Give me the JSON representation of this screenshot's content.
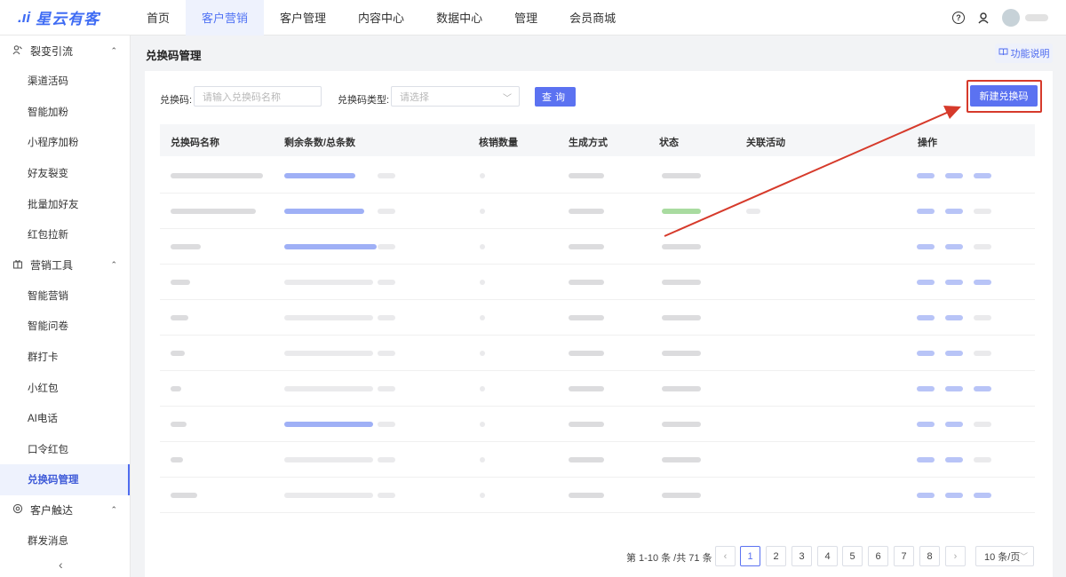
{
  "app": {
    "logo_mark": ".ıi",
    "name": "星云有客"
  },
  "nav": [
    {
      "label": "首页",
      "active": false
    },
    {
      "label": "客户营销",
      "active": true
    },
    {
      "label": "客户管理",
      "active": false
    },
    {
      "label": "内容中心",
      "active": false
    },
    {
      "label": "数据中心",
      "active": false
    },
    {
      "label": "管理",
      "active": false
    },
    {
      "label": "会员商城",
      "active": false
    }
  ],
  "topbar_icons": [
    "help-icon",
    "user-switch-icon"
  ],
  "sidebar": {
    "groups": [
      {
        "title": "裂变引流",
        "icon": "people-icon",
        "items": [
          "渠道活码",
          "智能加粉",
          "小程序加粉",
          "好友裂变",
          "批量加好友",
          "红包拉新"
        ]
      },
      {
        "title": "营销工具",
        "icon": "gift-icon",
        "items": [
          "智能营销",
          "智能问卷",
          "群打卡",
          "小红包",
          "AI电话",
          "口令红包",
          "兑换码管理"
        ]
      },
      {
        "title": "客户触达",
        "icon": "reach-icon",
        "items": [
          "群发消息"
        ]
      }
    ],
    "active_item": "兑换码管理",
    "collapse_glyph": "‹"
  },
  "page": {
    "title": "兑换码管理",
    "help_label": "功能说明"
  },
  "filters": {
    "code_label": "兑换码:",
    "code_placeholder": "请输入兑换码名称",
    "type_label": "兑换码类型:",
    "type_placeholder": "请选择",
    "query_label": "查询",
    "new_label": "新建兑换码"
  },
  "table": {
    "columns": [
      "兑换码名称",
      "剩余条数/总条数",
      "核销数量",
      "生成方式",
      "状态",
      "关联活动",
      "操作"
    ],
    "row_count": 10
  },
  "pagination": {
    "total_text": "第 1-10 条 /共 71 条",
    "pages": [
      "1",
      "2",
      "3",
      "4",
      "5",
      "6",
      "7",
      "8"
    ],
    "current": "1",
    "prev": "‹",
    "next": "›",
    "page_size": "10 条/页"
  },
  "colors": {
    "accent": "#5b72f1",
    "annotation": "#d63a2b"
  }
}
